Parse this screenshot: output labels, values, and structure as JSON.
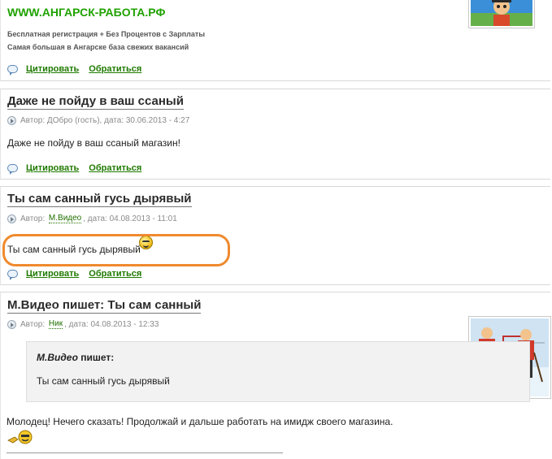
{
  "ad_post": {
    "site_title": "WWW.АНГАРСК-РАБОТА.РФ",
    "line1": "Бесплатная регистрация + Без Процентов с Зарплаты",
    "line2": "Самая большая в Ангарске база свежих вакансий",
    "quote_label": "Цитировать",
    "reply_label": "Обратиться"
  },
  "posts": [
    {
      "title": "Даже не пойду в ваш ссаный",
      "author_prefix": "Автор:",
      "author": "ДОбро (гость),",
      "date_label": "дата:",
      "date": "30.06.2013 - 4:27",
      "body": "Даже не пойду в ваш ссаный магазин!",
      "quote_label": "Цитировать",
      "reply_label": "Обратиться"
    },
    {
      "title": "Ты сам санный гусь дырявый",
      "author_prefix": "Автор:",
      "author": "М.Видео",
      "date_label": ", дата:",
      "date": "04.08.2013 - 11:01",
      "body": "Ты сам санный гусь дырявый",
      "quote_label": "Цитировать",
      "reply_label": "Обратиться"
    },
    {
      "title": "М.Видео пишет: Ты сам санный",
      "author_prefix": "Автор:",
      "author": "Ник",
      "date_label": ", дата:",
      "date": "04.08.2013 - 12:33",
      "quote_author": "М.Видео",
      "quote_writes": "пишет:",
      "quote_text": "Ты сам санный гусь дырявый",
      "body": "Молодец! Нечего сказать! Продолжай и дальше работать на имидж своего магазина."
    }
  ],
  "colors": {
    "accent_green": "#1f7a00",
    "ad_green": "#1fa200",
    "highlight_orange": "#ef8a2e"
  }
}
